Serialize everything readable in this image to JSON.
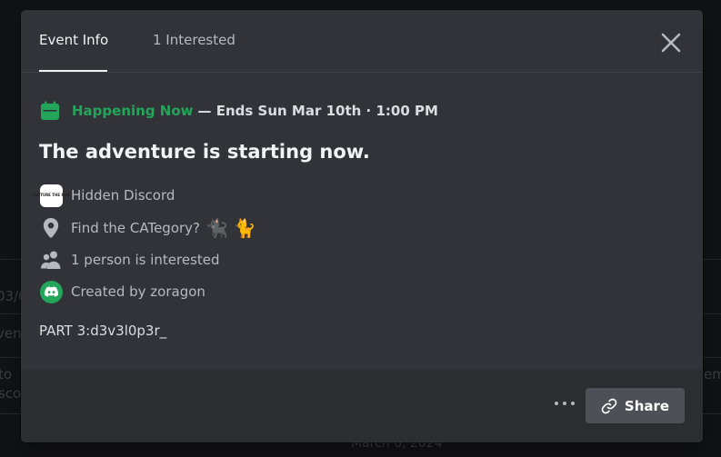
{
  "background": {
    "fragments": [
      "03/0",
      "ven",
      "to",
      "sco",
      "em",
      "March 6, 2024"
    ]
  },
  "tabs": [
    {
      "label": "Event Info",
      "active": true
    },
    {
      "label": "1 Interested",
      "active": false
    }
  ],
  "icons": {
    "close": "close-icon",
    "calendar": "calendar-icon",
    "location": "location-pin-icon",
    "people": "people-icon",
    "discord": "discord-icon",
    "more": "more-dots-icon",
    "link": "link-icon"
  },
  "event": {
    "status_now": "Happening Now",
    "status_end": "— Ends Sun Mar 10th · 1:00 PM",
    "title": "The adventure is starting now.",
    "server_name": "Hidden Discord",
    "server_icon_text": "CAPTURE THE FUN",
    "location": "Find the CATegory?",
    "location_emoji_1": "🐈‍⬛",
    "location_emoji_2": "🐈",
    "interested": "1 person is interested",
    "created_by": "Created by zoragon",
    "description": "PART 3:d3v3l0p3r_"
  },
  "footer": {
    "share_label": "Share"
  },
  "colors": {
    "accent_green": "#23a55a",
    "modal_bg": "#313338",
    "footer_bg": "#2b2d31",
    "button_bg": "#4e5058"
  }
}
